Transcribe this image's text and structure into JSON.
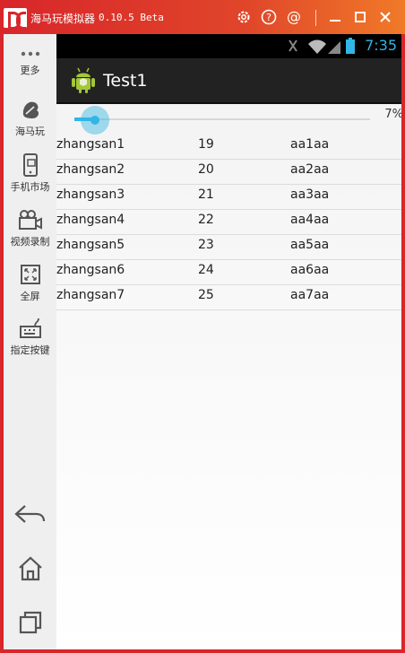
{
  "window": {
    "app_name": "海马玩模拟器",
    "version": "0.10.5 Beta"
  },
  "toolbar_icons": [
    "gear-icon",
    "help-icon",
    "at-icon",
    "minimize-icon",
    "maximize-icon",
    "close-icon"
  ],
  "sidebar": {
    "items": [
      {
        "label": "更多",
        "icon": "more-icon"
      },
      {
        "label": "海马玩",
        "icon": "haima-icon"
      },
      {
        "label": "手机市场",
        "icon": "market-icon"
      },
      {
        "label": "视频录制",
        "icon": "video-record-icon"
      },
      {
        "label": "全屏",
        "icon": "fullscreen-icon"
      },
      {
        "label": "指定按键",
        "icon": "keyboard-icon"
      }
    ],
    "nav": [
      "back-icon",
      "home-icon",
      "recent-apps-icon"
    ]
  },
  "status_bar": {
    "time": "7:35"
  },
  "action_bar": {
    "title": "Test1"
  },
  "seekbar": {
    "percent_label": "7%",
    "progress": 0.07
  },
  "list": {
    "rows": [
      {
        "name": "zhangsan1",
        "age": "19",
        "code": "aa1aa"
      },
      {
        "name": "zhangsan2",
        "age": "20",
        "code": "aa2aa"
      },
      {
        "name": "zhangsan3",
        "age": "21",
        "code": "aa3aa"
      },
      {
        "name": "zhangsan4",
        "age": "22",
        "code": "aa4aa"
      },
      {
        "name": "zhangsan5",
        "age": "23",
        "code": "aa5aa"
      },
      {
        "name": "zhangsan6",
        "age": "24",
        "code": "aa6aa"
      },
      {
        "name": "zhangsan7",
        "age": "25",
        "code": "aa7aa"
      }
    ]
  }
}
